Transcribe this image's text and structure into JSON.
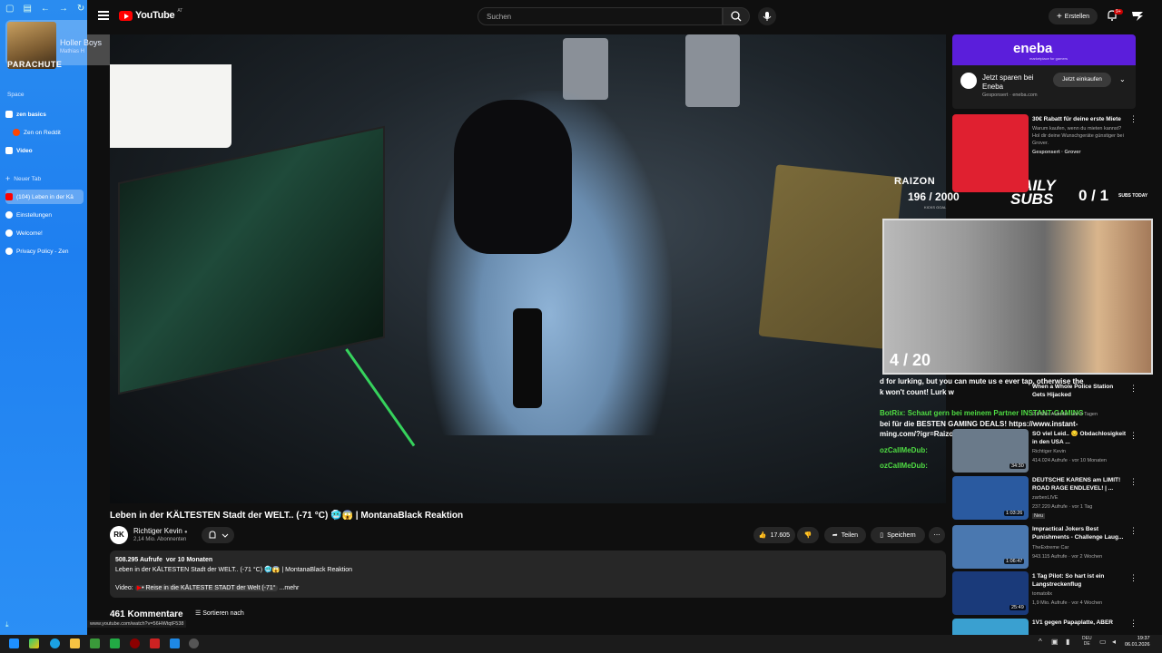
{
  "browser_sidebar": {
    "now_playing": {
      "title": "Holler Boys",
      "artist": "Mathias H",
      "art_text": "PARACHUTE"
    },
    "space_label": "Space",
    "items": [
      {
        "label": "zen basics",
        "color": "#ffffff"
      },
      {
        "label": "Zen on Reddit",
        "color": "#ff4500"
      },
      {
        "label": "Video",
        "color": "#ffffff"
      },
      {
        "label": "Neuer Tab",
        "color": "#ffffff"
      },
      {
        "label": "(104) Leben in der Kä",
        "color": "#ff0000"
      },
      {
        "label": "Einstellungen",
        "color": "#ffffff"
      },
      {
        "label": "Welcome!",
        "color": "#ffffff"
      },
      {
        "label": "Privacy Policy - Zen",
        "color": "#ffffff"
      }
    ],
    "status_url": "www.youtube.com/watch?v=56HWtqtF538"
  },
  "header": {
    "logo_text": "YouTube",
    "country_code": "AT",
    "search_placeholder": "Suchen",
    "create_label": "Erstellen",
    "notification_badge": "9+"
  },
  "video": {
    "title": "Leben in der KÄLTESTEN Stadt der WELT.. (-71 °C) 🥶😱 | MontanaBlack Reaktion",
    "channel": "Richtiger Kevin",
    "channel_avatar": "RK",
    "subscribers": "2,14 Mio. Abonnenten",
    "likes": "17.605",
    "share_label": "Teilen",
    "save_label": "Speichern",
    "views": "508.295 Aufrufe",
    "age": "vor 10 Monaten",
    "desc_line": "Leben in der KÄLTESTEN Stadt der WELT.. (-71 °C) 🥶😱 | MontanaBlack Reaktion",
    "desc_video_prefix": "Video:",
    "desc_video_link": "• Reise in die KÄLTESTE STADT der Welt (-71°",
    "more_label": "...mehr",
    "comments": "461 Kommentare",
    "sort_label": "Sortieren nach"
  },
  "overlay": {
    "raizon_logo": "RAIZON",
    "raizon_count": "196 / 2000",
    "raizon_goal": "KICKS GOAL",
    "daily_subs": "DAILY SUBS",
    "subs_count": "0 / 1",
    "subs_today": "SUBS TODAY",
    "cam_count": "4 / 20",
    "chat": [
      {
        "text": "d for lurking, but you can mute us e        ever tap, otherwise the",
        "color": "w"
      },
      {
        "text": "k won't count! Lurk w",
        "color": "w"
      },
      {
        "text": "BotRix: Schaut gern bei meinem Partner INSTANT-GAMING",
        "color": "g"
      },
      {
        "text": "bei für die BESTEN GAMING DEALS! https://www.instant-",
        "color": "w"
      },
      {
        "text": "ming.com/?igr=Raizon",
        "color": "w"
      },
      {
        "text": "ozCallMeDub:",
        "color": "g"
      },
      {
        "text": "ozCallMeDub:",
        "color": "g"
      }
    ]
  },
  "ad": {
    "brand": "eneba",
    "brand_sub": "marketplace for gamers",
    "headline": "Jetzt sparen bei Eneba",
    "sponsor": "Gesponsert · eneba.com",
    "cta": "Jetzt einkaufen"
  },
  "recommendations": [
    {
      "title": "30€ Rabatt für deine erste Miete",
      "channel": "Warum kaufen, wenn du mieten kannst? Hol dir deine Wunschgeräte günstiger bei Grover.",
      "meta": "Gesponsert · Grover",
      "duration": "",
      "thumb": "#e02030"
    },
    {
      "title": "When a Whole Police Station Gets Hijacked",
      "channel": "",
      "meta": "2,6 Mio. Aufrufe · vor 5 Tagen",
      "duration": "",
      "thumb": "#3a4a3a"
    },
    {
      "title": "SO viel Leid.. 😔 Obdachlosigkeit in den USA ...",
      "channel": "Richtiger Kevin",
      "meta": "414.024 Aufrufe · vor 10 Monaten",
      "duration": "34:30",
      "thumb": "#6a7a8a"
    },
    {
      "title": "DEUTSCHE KARENS am LIMIT! ROAD RAGE ENDLEVEL! | ...",
      "channel": "zarbexLIVE",
      "meta": "237.220 Aufrufe · vor 1 Tag",
      "duration": "1:03:26",
      "thumb": "#2a5aa0",
      "badge": "Neu"
    },
    {
      "title": "Impractical Jokers Best Punishments - Challenge Laug...",
      "channel": "TheExtreme Car",
      "meta": "943.115 Aufrufe · vor 2 Wochen",
      "duration": "1:06:47",
      "thumb": "#4a78b0"
    },
    {
      "title": "1 Tag Pilot: So hart ist ein Langstreckenflug",
      "channel": "tomatolix",
      "meta": "1,9 Mio. Aufrufe · vor 4 Wochen",
      "duration": "25:49",
      "thumb": "#1a3a7a"
    },
    {
      "title": "1V1 gegen Papaplatte, ABER",
      "channel": "",
      "meta": "",
      "duration": "",
      "thumb": "#3aa0d0"
    }
  ],
  "taskbar": {
    "lang": "DEU",
    "region": "DE",
    "time": "19:37",
    "date": "06.01.2026"
  }
}
